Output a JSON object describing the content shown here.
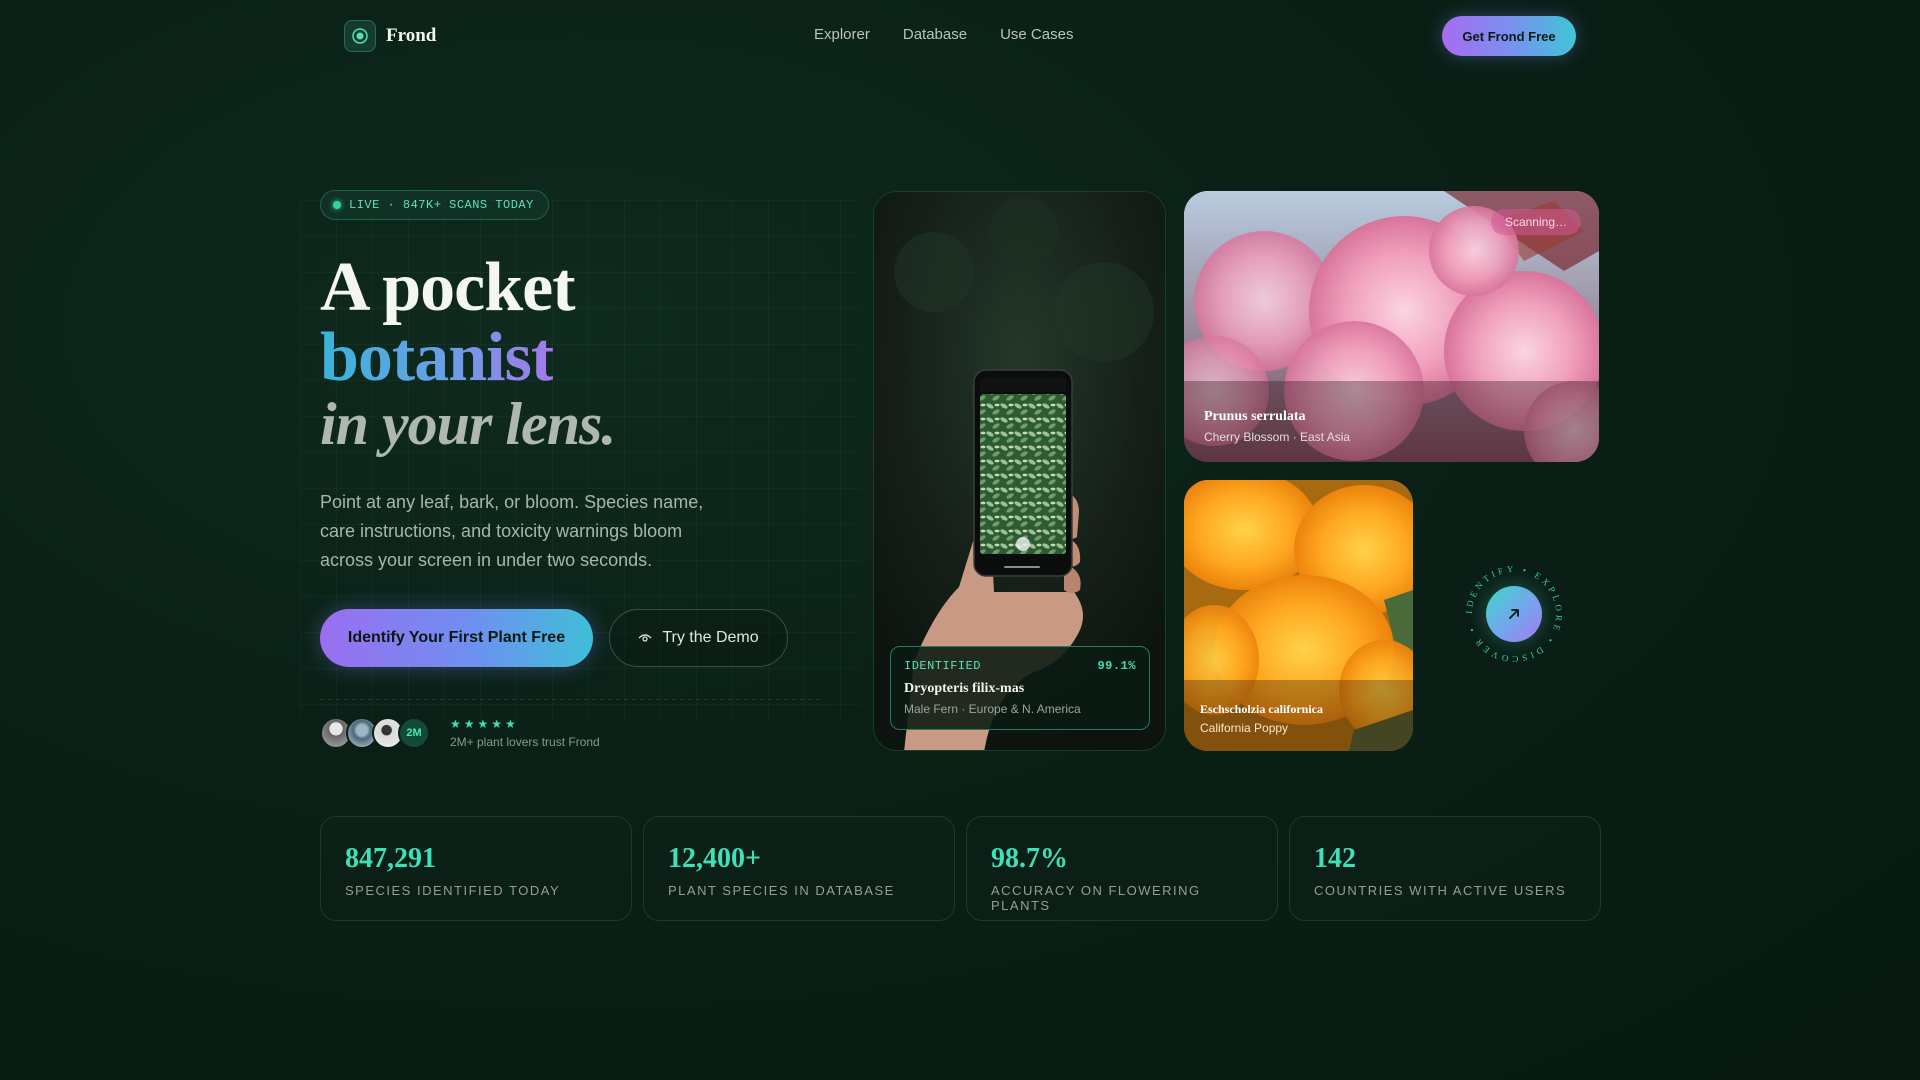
{
  "nav": {
    "brand": "Frond",
    "links": [
      "Explorer",
      "Database",
      "Use Cases"
    ],
    "cta": "Get Frond Free"
  },
  "hero": {
    "badge": "LIVE · 847K+ SCANS TODAY",
    "headline_1": "A pocket",
    "headline_2": "botanist",
    "headline_3": "in your lens.",
    "lede": "Point at any leaf, bark, or bloom. Species name, care instructions, and toxicity warnings bloom across your screen in under two seconds.",
    "primary_button": "Identify Your First Plant Free",
    "secondary_button": "Try the Demo",
    "avatar_count": "2M",
    "stars": "★★★★★",
    "trust_text": "2M+ plant lovers trust Frond"
  },
  "phone_card": {
    "status": "IDENTIFIED",
    "confidence": "99.1%",
    "species": "Dryopteris filix-mas",
    "details": "Male Fern · Europe & N. America"
  },
  "blossom_card": {
    "pill": "Scanning…",
    "species": "Prunus serrulata",
    "details": "Cherry Blossom · East Asia"
  },
  "poppy_card": {
    "species": "Eschscholzia californica",
    "details": "California Poppy"
  },
  "orbit": {
    "text": "IDENTIFY • EXPLORE • DISCOVER •",
    "icon": "arrow-up-right-icon"
  },
  "stats": [
    {
      "value": "847,291",
      "label": "SPECIES IDENTIFIED TODAY"
    },
    {
      "value": "12,400+",
      "label": "PLANT SPECIES IN DATABASE"
    },
    {
      "value": "98.7%",
      "label": "ACCURACY ON FLOWERING PLANTS"
    },
    {
      "value": "142",
      "label": "COUNTRIES WITH ACTIVE USERS"
    }
  ],
  "colors": {
    "background": "#0a1f16",
    "accent": "#3fe0b8",
    "gradient_start": "#9a6ef0",
    "gradient_end": "#3fbfd8"
  }
}
